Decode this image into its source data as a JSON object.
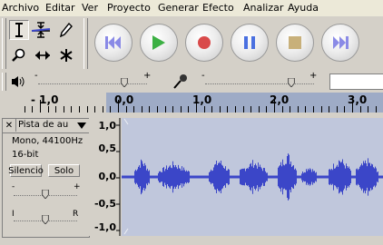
{
  "menu": [
    "Archivo",
    "Editar",
    "Ver",
    "Proyecto",
    "Generar",
    "Efecto",
    "Analizar",
    "Ayuda"
  ],
  "tools": [
    {
      "name": "selection-tool",
      "icon": "i-beam-icon",
      "active": true
    },
    {
      "name": "envelope-tool",
      "icon": "envelope-icon",
      "active": false
    },
    {
      "name": "draw-tool",
      "icon": "pencil-icon",
      "active": false
    },
    {
      "name": "zoom-tool",
      "icon": "magnifier-icon",
      "active": false
    },
    {
      "name": "timeshift-tool",
      "icon": "double-arrow-icon",
      "active": false
    },
    {
      "name": "multi-tool",
      "icon": "asterisk-icon",
      "active": false
    }
  ],
  "transport": [
    {
      "name": "skip-to-start-button",
      "icon": "skip-start-icon",
      "color": "#8a8ae6"
    },
    {
      "name": "play-button",
      "icon": "play-icon",
      "color": "#3cb043"
    },
    {
      "name": "record-button",
      "icon": "record-icon",
      "color": "#d94a4a"
    },
    {
      "name": "pause-button",
      "icon": "pause-icon",
      "color": "#4a70e0"
    },
    {
      "name": "stop-button",
      "icon": "stop-icon",
      "color": "#c8b07a"
    },
    {
      "name": "skip-to-end-button",
      "icon": "skip-end-icon",
      "color": "#8a8ae6"
    }
  ],
  "mixer": {
    "output_minus": "-",
    "output_plus": "+",
    "input_minus": "-",
    "input_plus": "+",
    "output_volume": 0.79,
    "input_volume": 0.79
  },
  "ruler": {
    "labels": [
      "- 1,0",
      "0,0",
      "1,0",
      "2,0",
      "3,0"
    ],
    "selection_color": "#9eabc6"
  },
  "track": {
    "name": "Pista de au",
    "close_label": "✕",
    "info_rate": "Mono, 44100Hz",
    "info_bits": "16-bit",
    "silence_label": "Silencio",
    "solo_label": "Solo",
    "gain_minus": "-",
    "gain_plus": "+",
    "pan_left": "I",
    "pan_right": "R",
    "gain": 0.5,
    "pan": 0.5
  },
  "amplitude_labels": [
    "1,0",
    "0,5",
    "0,0",
    "-0,5",
    "-1,0"
  ],
  "colors": {
    "waveform": "#3b46c8",
    "wave_bg": "#c0c7dc",
    "menubar": "#ece9d8",
    "chrome": "#d4d0c8"
  }
}
